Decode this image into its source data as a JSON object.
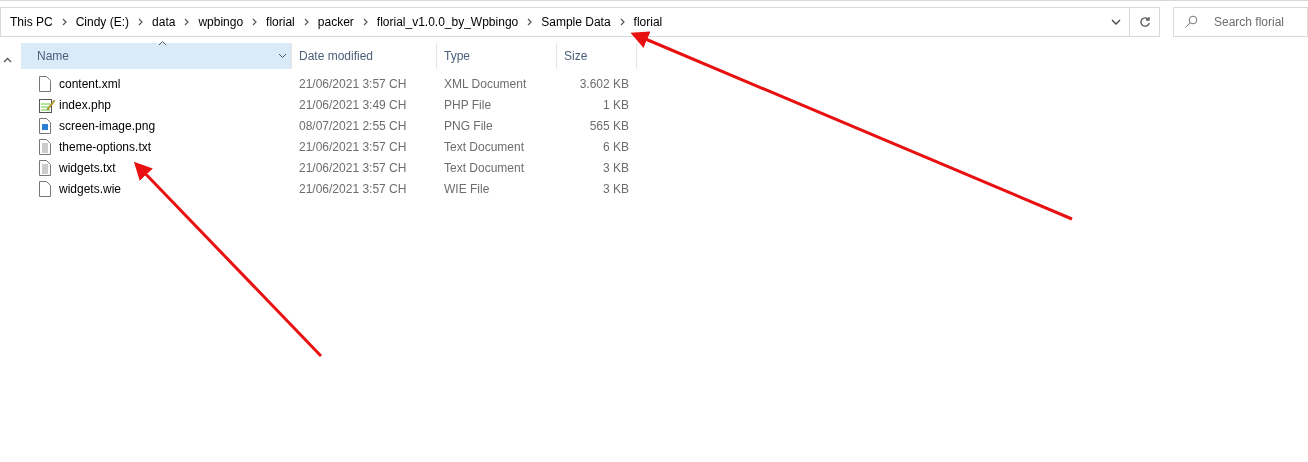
{
  "address_bar": {
    "breadcrumbs": [
      "This PC",
      "Cindy (E:)",
      "data",
      "wpbingo",
      "florial",
      "packer",
      "florial_v1.0.0_by_Wpbingo",
      "Sample Data",
      "florial"
    ]
  },
  "search": {
    "placeholder": "Search florial"
  },
  "table": {
    "columns": [
      {
        "label": "Name",
        "selected": true
      },
      {
        "label": "Date modified",
        "selected": false
      },
      {
        "label": "Type",
        "selected": false
      },
      {
        "label": "Size",
        "selected": false
      }
    ],
    "rows": [
      {
        "kind": "blank",
        "name": "content.xml",
        "date": "21/06/2021 3:57 CH",
        "type": "XML Document",
        "size": "3.602 KB"
      },
      {
        "kind": "script",
        "name": "index.php",
        "date": "21/06/2021 3:49 CH",
        "type": "PHP File",
        "size": "1 KB"
      },
      {
        "kind": "image",
        "name": "screen-image.png",
        "date": "08/07/2021 2:55 CH",
        "type": "PNG File",
        "size": "565 KB"
      },
      {
        "kind": "text",
        "name": "theme-options.txt",
        "date": "21/06/2021 3:57 CH",
        "type": "Text Document",
        "size": "6 KB"
      },
      {
        "kind": "text",
        "name": "widgets.txt",
        "date": "21/06/2021 3:57 CH",
        "type": "Text Document",
        "size": "3 KB"
      },
      {
        "kind": "blank",
        "name": "widgets.wie",
        "date": "21/06/2021 3:57 CH",
        "type": "WIE File",
        "size": "3 KB"
      }
    ]
  }
}
